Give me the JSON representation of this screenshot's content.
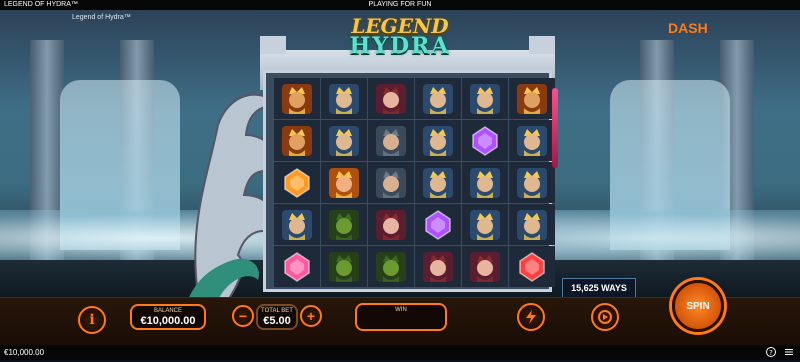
{
  "header": {
    "title": "LEGEND OF HYDRA™",
    "status": "PLAYING FOR FUN"
  },
  "game_subtitle": "Legend of Hydra™",
  "logo": {
    "line1": "LEGEND",
    "line2": "HYDRA"
  },
  "brand": {
    "prefix": "",
    "accent": "ASH",
    "mark": "D"
  },
  "reels": {
    "rows": [
      [
        "king-orange",
        "king-blue",
        "princess",
        "king-blue",
        "king-blue",
        "king-orange"
      ],
      [
        "king-orange",
        "king-blue",
        "warrior",
        "king-blue",
        "gem-purple",
        "king-blue"
      ],
      [
        "gem-orange",
        "queen",
        "warrior",
        "king-blue",
        "king-blue",
        "king-blue"
      ],
      [
        "king-blue",
        "knight-green",
        "princess",
        "gem-purple",
        "king-blue",
        "king-blue"
      ],
      [
        "gem-pink",
        "knight-green",
        "knight-green",
        "princess",
        "princess",
        "gem-heart"
      ]
    ]
  },
  "ways_label": "15,625 WAYS",
  "controls": {
    "info_icon": "info-icon",
    "balance_label": "BALANCE",
    "balance_value": "€10,000.00",
    "totalbet_label": "TOTAL BET",
    "totalbet_value": "€5.00",
    "minus_label": "−",
    "plus_label": "+",
    "win_label": "WIN",
    "win_value": "",
    "spin_label": "SPIN"
  },
  "footer": {
    "balance": "€10,000.00"
  },
  "colors": {
    "accent": "#ff7a1a",
    "gold": "#f4c94a",
    "teal": "#5fe0d0"
  }
}
